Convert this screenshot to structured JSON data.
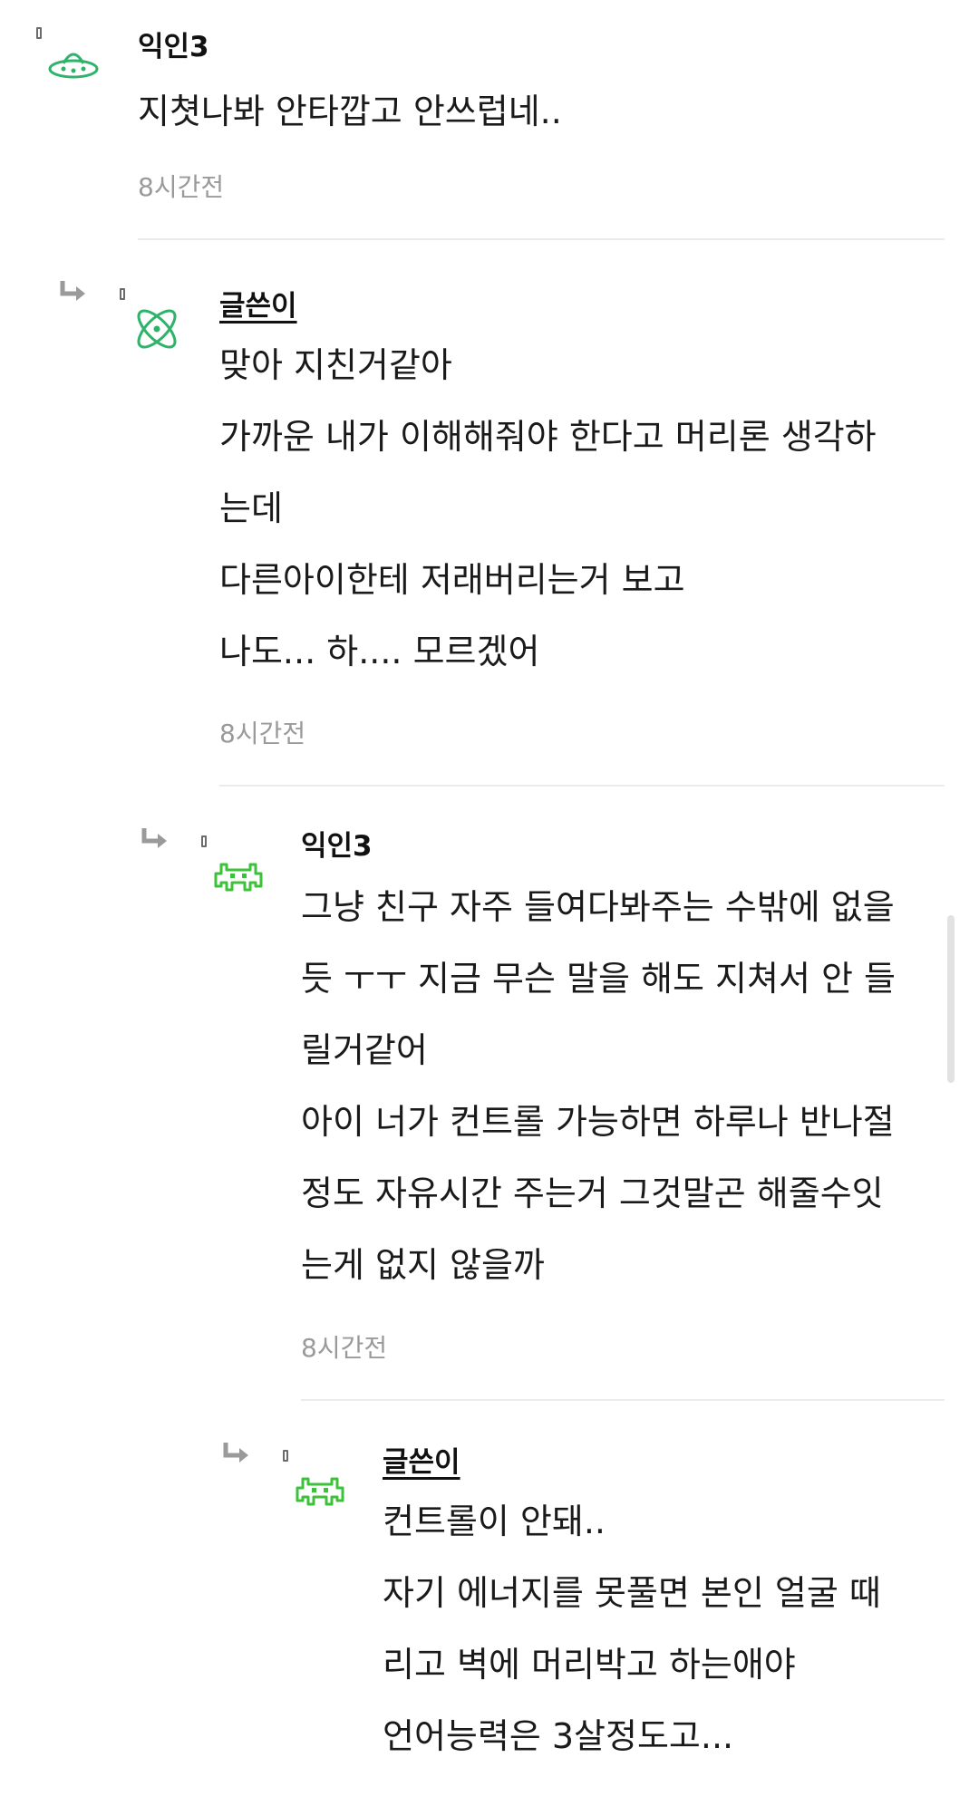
{
  "comments": [
    {
      "author": "익인3",
      "lines": [
        "지쳣나봐 안타깝고 안쓰럽네.."
      ],
      "time": "8시간전"
    },
    {
      "author": "글쓴이",
      "lines": [
        "맞아 지친거같아",
        "가까운 내가 이해해줘야 한다고 머리론 생각하",
        "는데",
        "다른아이한테 저래버리는거 보고",
        "나도... 하.... 모르겠어"
      ],
      "time": "8시간전"
    },
    {
      "author": "익인3",
      "lines": [
        "그냥 친구 자주 들여다봐주는 수밖에 없을",
        "듯 ㅜㅜ 지금 무슨 말을 해도 지쳐서 안 들",
        "릴거같어",
        "아이 너가 컨트롤 가능하면 하루나 반나절",
        "정도 자유시간 주는거 그것말곤 해줄수잇",
        "는게 없지 않을까"
      ],
      "time": "8시간전"
    },
    {
      "author": "글쓴이",
      "lines": [
        "컨트롤이 안돼..",
        "자기 에너지를 못풀면 본인 얼굴 때",
        "리고 벽에 머리박고 하는애야",
        "언어능력은 3살정도고..."
      ],
      "time": ""
    }
  ],
  "icons": {
    "c0_avatar": "ufo-icon",
    "c1_avatar": "atom-icon",
    "c2_avatar": "space-invader-icon",
    "c3_avatar": "space-invader-icon",
    "reply": "reply-arrow-icon"
  },
  "colors": {
    "avatar_green": "#2fb36b",
    "invader_green": "#3cc23a",
    "text": "#1a1a1a",
    "time": "#9a9a9a",
    "divider": "#ebebeb"
  }
}
